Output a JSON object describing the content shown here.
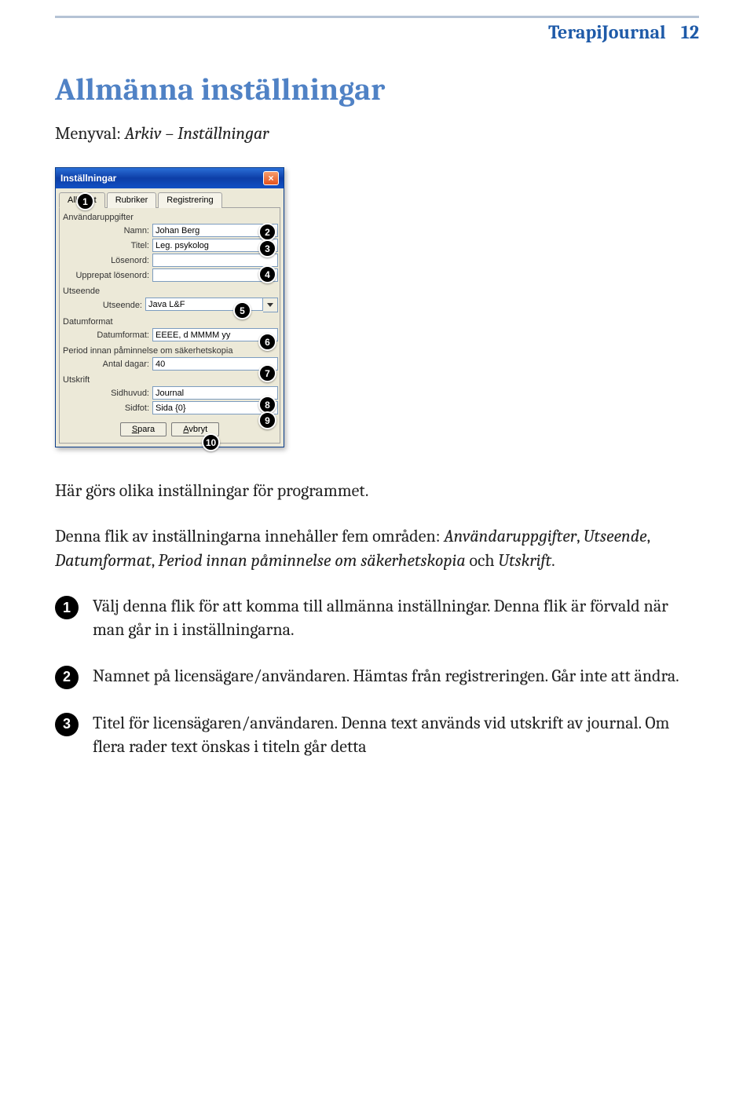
{
  "header": {
    "title": "TerapiJournal",
    "page_number": "12"
  },
  "section_title": "Allmänna inställningar",
  "menupath": {
    "label": "Menyval: ",
    "path": "Arkiv – Inställningar"
  },
  "dialog": {
    "title": "Inställningar",
    "tabs": [
      "Allmänt",
      "Rubriker",
      "Registrering"
    ],
    "groups": {
      "user": {
        "legend": "Användaruppgifter",
        "name_label": "Namn:",
        "name_value": "Johan Berg",
        "title_label": "Titel:",
        "title_value": "Leg. psykolog",
        "password_label": "Lösenord:",
        "password_value": "",
        "password2_label": "Upprepat lösenord:",
        "password2_value": ""
      },
      "appearance": {
        "legend": "Utseende",
        "label": "Utseende:",
        "value": "Java L&F"
      },
      "dateformat": {
        "legend": "Datumformat",
        "label": "Datumformat:",
        "value": "EEEE, d MMMM yy"
      },
      "backup": {
        "legend": "Period innan påminnelse om säkerhetskopia",
        "label": "Antal dagar:",
        "value": "40"
      },
      "print": {
        "legend": "Utskrift",
        "header_label": "Sidhuvud:",
        "header_value": "Journal",
        "footer_label": "Sidfot:",
        "footer_value": "Sida {0}"
      }
    },
    "buttons": {
      "save": "Spara",
      "cancel": "Avbryt"
    }
  },
  "badges": {
    "b1": "1",
    "b2": "2",
    "b3": "3",
    "b4": "4",
    "b5": "5",
    "b6": "6",
    "b7": "7",
    "b8": "8",
    "b9": "9",
    "b10": "10"
  },
  "intro": {
    "line1": "Här görs olika inställningar för programmet.",
    "p2_a": "Denna flik av inställningarna innehåller fem områden: ",
    "p2_em1": "Användaruppgifter",
    "p2_b": ", ",
    "p2_em2": "Utseende",
    "p2_c": ", ",
    "p2_em3": "Datumformat",
    "p2_d": ", ",
    "p2_em4": "Period innan påminnelse om säkerhetskopia",
    "p2_e": " och ",
    "p2_em5": "Utskrift",
    "p2_f": "."
  },
  "list": {
    "n1": "1",
    "t1": "Välj denna flik för att komma till allmänna inställningar. Denna flik är förvald när man går in i inställningarna.",
    "n2": "2",
    "t2": "Namnet på licensägare/användaren. Hämtas från registreringen. Går inte att ändra.",
    "n3": "3",
    "t3": "Titel för licensägaren/användaren. Denna text används vid utskrift av journal. Om flera rader text önskas i titeln går detta"
  }
}
